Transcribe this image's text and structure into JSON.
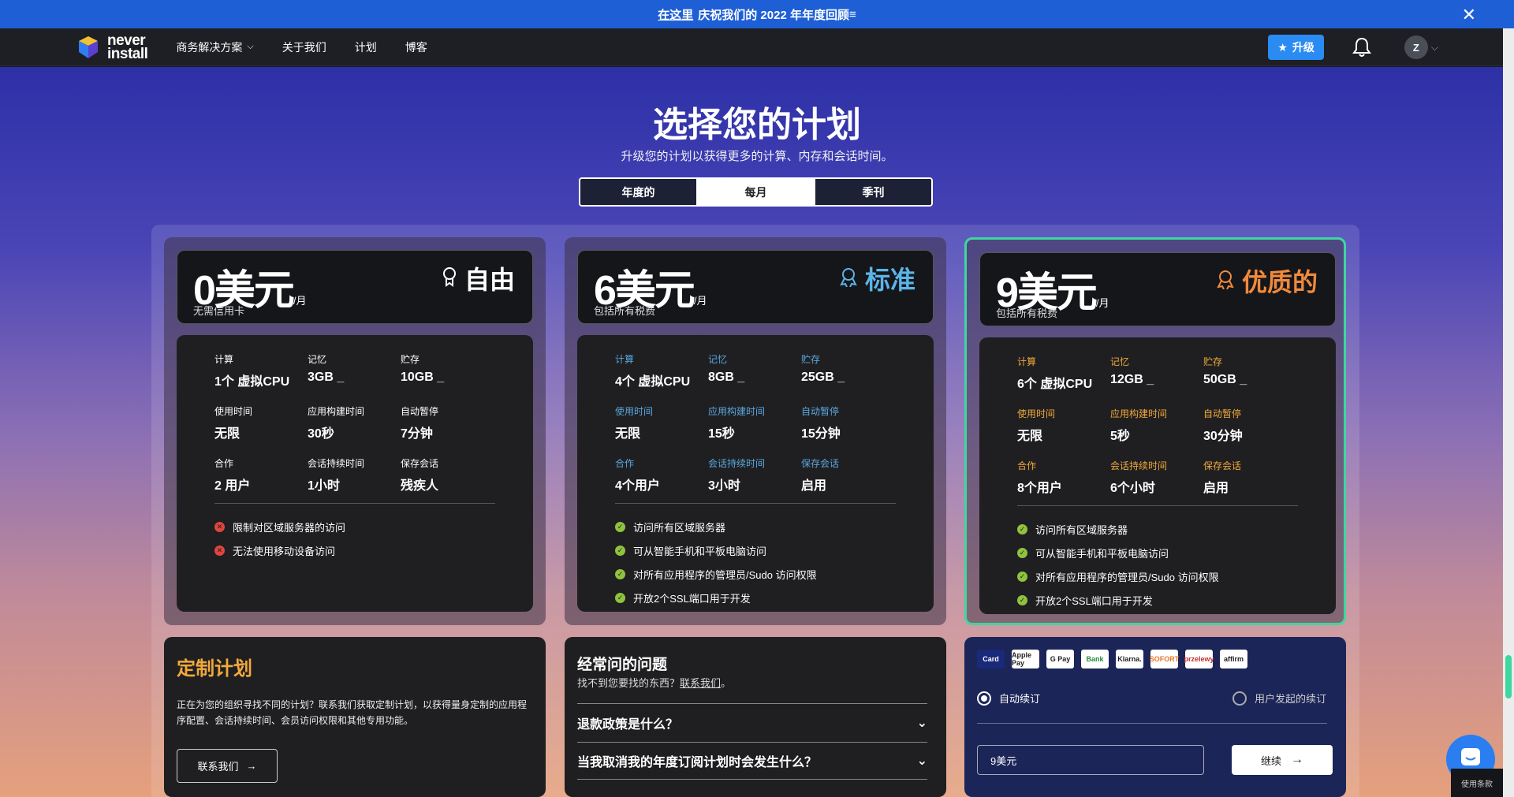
{
  "banner": {
    "link": "在这里",
    "text": "庆祝我们的 2022 年年度回顾"
  },
  "nav": {
    "logo_line1": "never",
    "logo_line2": "install",
    "items": [
      "商务解决方案",
      "关于我们",
      "计划",
      "博客"
    ],
    "upgrade": "升级",
    "avatar": "Z"
  },
  "hero": {
    "title": "选择您的计划",
    "subtitle": "升级您的计划以获得更多的计算、内存和会话时间。"
  },
  "tabs": [
    "年度的",
    "每月",
    "季刊"
  ],
  "active_tab": "每月",
  "plans": [
    {
      "price": "0美元",
      "per": "/月",
      "note": "无需信用卡",
      "tier": "自由",
      "tier_color": "#ffffff",
      "label_color": "#ffffff",
      "specs": [
        {
          "label": "计算",
          "value": "1个 虚拟CPU"
        },
        {
          "label": "记忆",
          "value": "3GB _"
        },
        {
          "label": "贮存",
          "value": "10GB _"
        },
        {
          "label": "使用时间",
          "value": "无限"
        },
        {
          "label": "应用构建时间",
          "value": "30秒"
        },
        {
          "label": "自动暂停",
          "value": "7分钟"
        },
        {
          "label": "合作",
          "value": "2 用户"
        },
        {
          "label": "会话持续时间",
          "value": "1小时"
        },
        {
          "label": "保存会话",
          "value": "残疾人"
        }
      ],
      "features": [
        {
          "text": "限制对区域服务器的访问",
          "ok": false
        },
        {
          "text": "无法使用移动设备访问",
          "ok": false
        }
      ]
    },
    {
      "price": "6美元",
      "per": "/月",
      "note": "包括所有税费",
      "tier": "标准",
      "tier_color": "#5bb4e8",
      "label_color": "#5aa8e0",
      "specs": [
        {
          "label": "计算",
          "value": "4个 虚拟CPU"
        },
        {
          "label": "记忆",
          "value": "8GB _"
        },
        {
          "label": "贮存",
          "value": "25GB _"
        },
        {
          "label": "使用时间",
          "value": "无限"
        },
        {
          "label": "应用构建时间",
          "value": "15秒"
        },
        {
          "label": "自动暂停",
          "value": "15分钟"
        },
        {
          "label": "合作",
          "value": "4个用户"
        },
        {
          "label": "会话持续时间",
          "value": "3小时"
        },
        {
          "label": "保存会话",
          "value": "启用"
        }
      ],
      "features": [
        {
          "text": "访问所有区域服务器",
          "ok": true
        },
        {
          "text": "可从智能手机和平板电脑访问",
          "ok": true
        },
        {
          "text": "对所有应用程序的管理员/Sudo 访问权限",
          "ok": true
        },
        {
          "text": "开放2个SSL端口用于开发",
          "ok": true
        }
      ]
    },
    {
      "price": "9美元",
      "per": "/月",
      "note": "包括所有税费",
      "tier": "优质的",
      "tier_color": "#f08a3c",
      "label_color": "#f0a93b",
      "specs": [
        {
          "label": "计算",
          "value": "6个 虚拟CPU"
        },
        {
          "label": "记忆",
          "value": "12GB _"
        },
        {
          "label": "贮存",
          "value": "50GB _"
        },
        {
          "label": "使用时间",
          "value": "无限"
        },
        {
          "label": "应用构建时间",
          "value": "5秒"
        },
        {
          "label": "自动暂停",
          "value": "30分钟"
        },
        {
          "label": "合作",
          "value": "8个用户"
        },
        {
          "label": "会话持续时间",
          "value": "6个小时"
        },
        {
          "label": "保存会话",
          "value": "启用"
        }
      ],
      "features": [
        {
          "text": "访问所有区域服务器",
          "ok": true
        },
        {
          "text": "可从智能手机和平板电脑访问",
          "ok": true
        },
        {
          "text": "对所有应用程序的管理员/Sudo 访问权限",
          "ok": true
        },
        {
          "text": "开放2个SSL端口用于开发",
          "ok": true
        }
      ]
    }
  ],
  "custom": {
    "title": "定制计划",
    "text": "正在为您的组织寻找不同的计划？联系我们获取定制计划，以获得量身定制的应用程序配置、会话持续时间、会员访问权限和其他专用功能。",
    "button": "联系我们"
  },
  "faq": {
    "title": "经常问的问题",
    "sub_prefix": "找不到您要找的东西？",
    "sub_link": "联系我们",
    "sub_suffix": "。",
    "questions": [
      "退款政策是什么？",
      "当我取消我的年度订阅计划时会发生什么？"
    ]
  },
  "payment": {
    "icons": [
      "Card",
      "Apple Pay",
      "G Pay",
      "Bank",
      "Klarna.",
      "SOFORT",
      "przelewy",
      "affirm"
    ],
    "auto_renew": "自动续订",
    "user_renew": "用户发起的续订",
    "amount": "9美元",
    "continue": "继续"
  },
  "corner_tag": "使用条款"
}
